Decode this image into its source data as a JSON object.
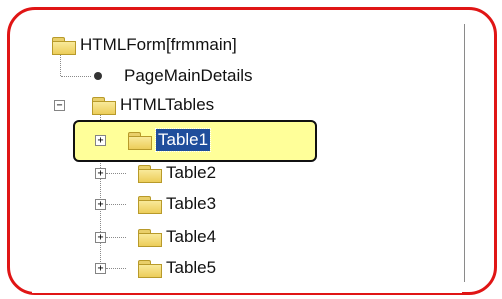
{
  "tree": {
    "root": {
      "label": "HTMLForm[frmmain]",
      "icon": "folder-icon"
    },
    "items": [
      {
        "label": "PageMainDetails",
        "icon": "bullet-icon"
      },
      {
        "label": "HTMLTables",
        "icon": "folder-open-icon",
        "expander": "−"
      }
    ],
    "tables": [
      {
        "label": "Table1",
        "expander": "+",
        "selected": true
      },
      {
        "label": "Table2",
        "expander": "+"
      },
      {
        "label": "Table3",
        "expander": "+"
      },
      {
        "label": "Table4",
        "expander": "+"
      },
      {
        "label": "Table5",
        "expander": "+"
      }
    ]
  },
  "colors": {
    "callout_border": "#e01515",
    "highlight": "#ffff99",
    "selection": "#1f4e9c"
  }
}
